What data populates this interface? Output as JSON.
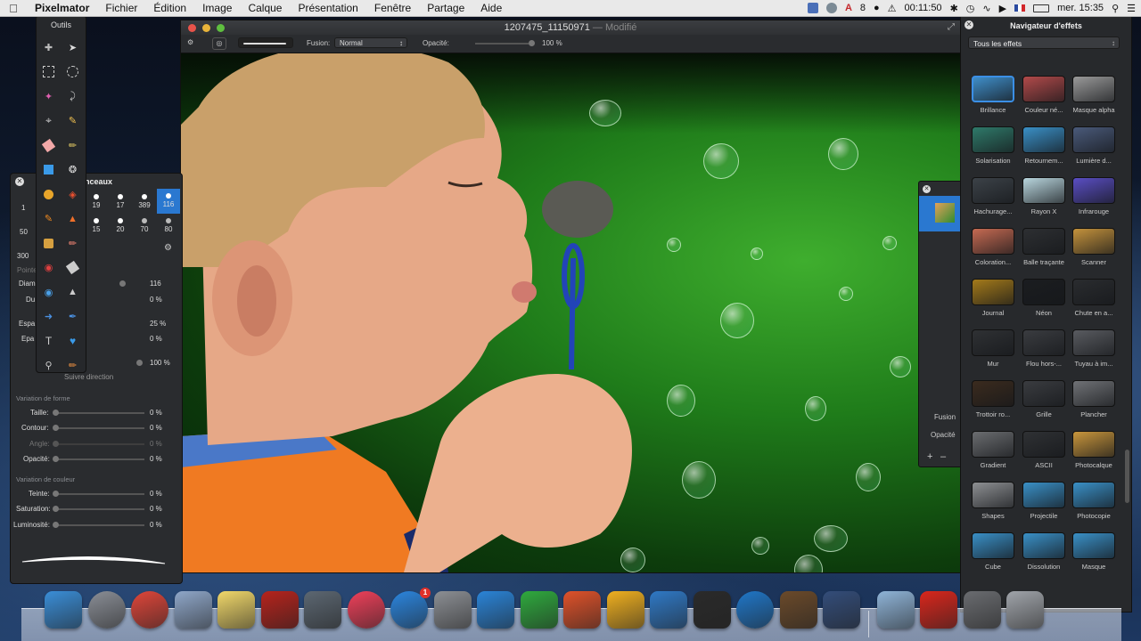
{
  "menubar": {
    "app_name": "Pixelmator",
    "items": [
      "Fichier",
      "Édition",
      "Image",
      "Calque",
      "Présentation",
      "Fenêtre",
      "Partage",
      "Aide"
    ],
    "battery_num": "8",
    "timer": "00:11:50",
    "clock": "mer. 15:35"
  },
  "tools_palette": {
    "title": "Outils"
  },
  "brushes_panel": {
    "title": "nceaux",
    "sizes_row1": [
      "19",
      "17",
      "389",
      "116"
    ],
    "sizes_row2": [
      "15",
      "20",
      "70",
      "80"
    ],
    "left_labels": [
      "1",
      "50",
      "300"
    ],
    "row_labels": [
      "Pointe",
      "Diam",
      "Du",
      "Espa",
      "Epa"
    ],
    "values": {
      "diameter": "116",
      "hardness": "0 %",
      "spacing": "25 %",
      "thickness": "0 %",
      "opacity": "100 %"
    },
    "follow_direction": "Suivre direction",
    "shape_section": "Variation de forme",
    "shape_rows": [
      {
        "label": "Taille:",
        "value": "0 %"
      },
      {
        "label": "Contour:",
        "value": "0 %"
      },
      {
        "label": "Angle:",
        "value": "0 %"
      },
      {
        "label": "Opacité:",
        "value": "0 %"
      }
    ],
    "color_section": "Variation de couleur",
    "color_rows": [
      {
        "label": "Teinte:",
        "value": "0 %"
      },
      {
        "label": "Saturation:",
        "value": "0 %"
      },
      {
        "label": "Luminosité:",
        "value": "0 %"
      }
    ]
  },
  "main_window": {
    "title": "1207475_11150971",
    "modified": " — Modifié",
    "fusion_label": "Fusion:",
    "fusion_value": "Normal",
    "opacity_label": "Opacité:",
    "opacity_value": "100 %"
  },
  "layers_panel": {
    "fusion_label": "Fusion",
    "opacity_label": "Opacité",
    "add": "+",
    "remove": "–"
  },
  "effects_panel": {
    "title": "Navigateur d'effets",
    "filter": "Tous les effets",
    "items": [
      {
        "label": "Brillance",
        "color": "#3f8ec9"
      },
      {
        "label": "Couleur né...",
        "color": "#b24a4a"
      },
      {
        "label": "Masque alpha",
        "color": "#9a9a9a"
      },
      {
        "label": "Solarisation",
        "color": "#2f7a6a"
      },
      {
        "label": "Retournem...",
        "color": "#3a90c7"
      },
      {
        "label": "Lumière d...",
        "color": "#4a5a7a"
      },
      {
        "label": "Hachurage...",
        "color": "#3c4248"
      },
      {
        "label": "Rayon X",
        "color": "#b9d6de"
      },
      {
        "label": "Infrarouge",
        "color": "#5a4ec4"
      },
      {
        "label": "Coloration...",
        "color": "#c66a52"
      },
      {
        "label": "Balle traçante",
        "color": "#2d2f32"
      },
      {
        "label": "Scanner",
        "color": "#c4923c"
      },
      {
        "label": "Journal",
        "color": "#a47a1a"
      },
      {
        "label": "Néon",
        "color": "#1b1d20"
      },
      {
        "label": "Chute en a...",
        "color": "#2a2c2f"
      },
      {
        "label": "Mur",
        "color": "#2f3134"
      },
      {
        "label": "Flou hors-...",
        "color": "#3a3c40"
      },
      {
        "label": "Tuyau à im...",
        "color": "#595b60"
      },
      {
        "label": "Trottoir ro...",
        "color": "#3b2b1e"
      },
      {
        "label": "Grille",
        "color": "#3a3c40"
      },
      {
        "label": "Plancher",
        "color": "#707276"
      },
      {
        "label": "Gradient",
        "color": "#6b6d70"
      },
      {
        "label": "ASCII",
        "color": "#2f3134"
      },
      {
        "label": "Photocalque",
        "color": "#c9963c"
      },
      {
        "label": "Shapes",
        "color": "#8e9093"
      },
      {
        "label": "Projectile",
        "color": "#3a90c7"
      },
      {
        "label": "Photocopie",
        "color": "#3a90c7"
      },
      {
        "label": "Cube",
        "color": "#3a90c7"
      },
      {
        "label": "Dissolution",
        "color": "#3a90c7"
      },
      {
        "label": "Masque",
        "color": "#3a90c7"
      }
    ]
  },
  "dock": {
    "apps": [
      {
        "name": "finder",
        "color": "#3a8ed8"
      },
      {
        "name": "launchpad",
        "color": "#8a8e96"
      },
      {
        "name": "chrome",
        "color": "#e0463a"
      },
      {
        "name": "preview-mail",
        "color": "#8fa7c9"
      },
      {
        "name": "stickies",
        "color": "#f1d86a"
      },
      {
        "name": "photo-booth",
        "color": "#b6231c"
      },
      {
        "name": "image-capture",
        "color": "#5c6772"
      },
      {
        "name": "itunes",
        "color": "#f0405a"
      },
      {
        "name": "app-store",
        "color": "#2b86e0"
      },
      {
        "name": "system-preferences",
        "color": "#8c8f94"
      },
      {
        "name": "word",
        "color": "#2a84d8"
      },
      {
        "name": "excel",
        "color": "#2faa3e"
      },
      {
        "name": "powerpoint",
        "color": "#e0522a"
      },
      {
        "name": "outlook",
        "color": "#f0b020"
      },
      {
        "name": "xcode",
        "color": "#2f79c6"
      },
      {
        "name": "unity",
        "color": "#2a2a2a"
      },
      {
        "name": "teamviewer",
        "color": "#1f77c9"
      },
      {
        "name": "pixelmator",
        "color": "#6b4a2a"
      },
      {
        "name": "image-viewer",
        "color": "#334d7a"
      },
      {
        "name": "folder",
        "color": "#8fb4d8"
      },
      {
        "name": "acrobat",
        "color": "#d9261c"
      },
      {
        "name": "downloads",
        "color": "#6a6c70"
      },
      {
        "name": "trash",
        "color": "#a0a4aa"
      }
    ],
    "app_store_badge": "1"
  }
}
